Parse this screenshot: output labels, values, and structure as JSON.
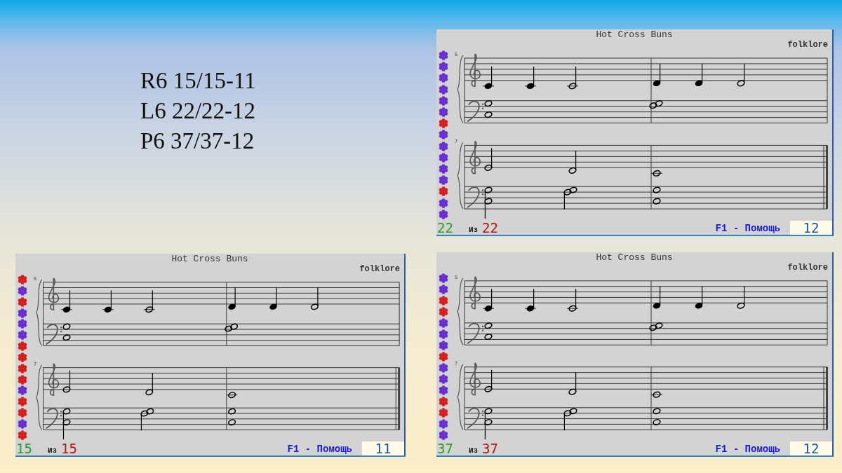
{
  "slide_text": [
    "R6 15/15-11",
    "L6 22/22-12",
    "P6 37/37-12"
  ],
  "panels": [
    {
      "title": "Hot Cross Buns",
      "composer": "folklore",
      "measure_numbers": [
        "5",
        "7"
      ],
      "flowers": [
        {
          "color": "#6a2fd0"
        },
        {
          "color": "#6a2fd0"
        },
        {
          "color": "#6a2fd0"
        },
        {
          "color": "#6a2fd0"
        },
        {
          "color": "#6a2fd0"
        },
        {
          "color": "#6a2fd0"
        },
        {
          "color": "#d42020"
        },
        {
          "color": "#6a2fd0"
        },
        {
          "color": "#6a2fd0"
        },
        {
          "color": "#6a2fd0"
        },
        {
          "color": "#6a2fd0"
        },
        {
          "color": "#6a2fd0"
        },
        {
          "color": "#d42020"
        },
        {
          "color": "#6a2fd0"
        },
        {
          "color": "#6a2fd0"
        }
      ],
      "footer": {
        "done": "22",
        "of_label": "Из",
        "total": "22",
        "help": "F1 - Помощь",
        "score": "12"
      }
    },
    {
      "title": "Hot Cross Buns",
      "composer": "folklore",
      "measure_numbers": [
        "5",
        "7"
      ],
      "flowers": [
        {
          "color": "#d42020"
        },
        {
          "color": "#6a2fd0"
        },
        {
          "color": "#d42020"
        },
        {
          "color": "#6a2fd0"
        },
        {
          "color": "#6a2fd0"
        },
        {
          "color": "#6a2fd0"
        },
        {
          "color": "#d42020"
        },
        {
          "color": "#d42020"
        },
        {
          "color": "#d42020"
        },
        {
          "color": "#d42020"
        },
        {
          "color": "#6a2fd0"
        },
        {
          "color": "#d42020"
        },
        {
          "color": "#d42020"
        },
        {
          "color": "#6a2fd0"
        },
        {
          "color": "#d42020"
        }
      ],
      "footer": {
        "done": "15",
        "of_label": "Из",
        "total": "15",
        "help": "F1 - Помощь",
        "score": "11"
      }
    },
    {
      "title": "Hot Cross Buns",
      "composer": "folklore",
      "measure_numbers": [
        "5",
        "7"
      ],
      "flowers": [
        {
          "color": "#6a2fd0"
        },
        {
          "color": "#6a2fd0"
        },
        {
          "color": "#d42020"
        },
        {
          "color": "#d42020"
        },
        {
          "color": "#6a2fd0"
        },
        {
          "color": "#6a2fd0"
        },
        {
          "color": "#6a2fd0"
        },
        {
          "color": "#d42020"
        },
        {
          "color": "#6a2fd0"
        },
        {
          "color": "#6a2fd0"
        },
        {
          "color": "#6a2fd0"
        },
        {
          "color": "#d42020"
        },
        {
          "color": "#d42020"
        },
        {
          "color": "#6a2fd0"
        },
        {
          "color": "#6a2fd0"
        }
      ],
      "footer": {
        "done": "37",
        "of_label": "Из",
        "total": "37",
        "help": "F1 - Помощь",
        "score": "12"
      }
    }
  ]
}
